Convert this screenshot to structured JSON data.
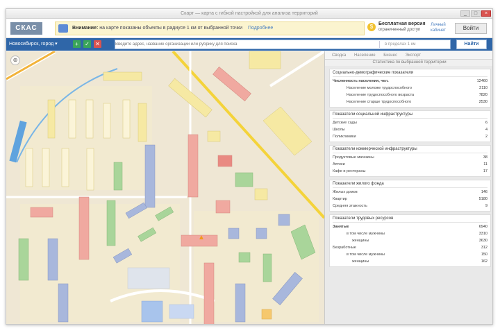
{
  "window": {
    "title": "Скарт — карта с гибкой настройкой для анализа территорий",
    "controls": [
      "_",
      "□",
      "×"
    ]
  },
  "header": {
    "logo": "СКАС",
    "banner": {
      "lead": "Внимание:",
      "text": "на карте показаны объекты в радиусе 1 км от выбранной точки",
      "link": "Подробнее"
    },
    "promo": {
      "title": "Бесплатная версия",
      "subtitle": "ограниченный доступ"
    },
    "user_link": "Личный кабинет",
    "login_label": "Войти"
  },
  "toolbar": {
    "city": "Новосибирск, город ▾",
    "buttons": [
      {
        "glyph": "+",
        "color": "#3aa55a"
      },
      {
        "glyph": "✓",
        "color": "#3aa55a"
      },
      {
        "glyph": "✕",
        "color": "#d9534f"
      }
    ],
    "search_placeholder": "Введите адрес, название организации или рубрику для поиска",
    "filter_label": "в пределах 1 км",
    "find_label": "Найти"
  },
  "map": {
    "compass": "⊕",
    "colors": {
      "road": "#ffffff",
      "main_road": "#f4d33a",
      "water": "#79b6e6",
      "residential": "#f2e9c7",
      "red": "#f0a9a0",
      "green": "#a9d59a",
      "blue": "#a8b7dc",
      "yellow": "#f6e9a3"
    }
  },
  "panel": {
    "tabs": [
      "Сводка",
      "Население",
      "Бизнес",
      "Экспорт"
    ],
    "subtitle": "Статистика по выбранной территории",
    "sections": [
      {
        "title": "Социально-демографические показатели",
        "rows": [
          {
            "label": "Численность населения, чел.",
            "value": "12460",
            "style": "bold"
          },
          {
            "label": "Население моложе трудоспособного",
            "value": "2110",
            "style": "indent"
          },
          {
            "label": "Население трудоспособного возраста",
            "value": "7820",
            "style": "indent"
          },
          {
            "label": "Население старше трудоспособного",
            "value": "2530",
            "style": "indent"
          }
        ]
      },
      {
        "title": "Показатели социальной инфраструктуры",
        "rows": [
          {
            "label": "Детские сады",
            "value": "6",
            "style": ""
          },
          {
            "label": "Школы",
            "value": "4",
            "style": ""
          },
          {
            "label": "Поликлиники",
            "value": "2",
            "style": ""
          }
        ]
      },
      {
        "title": "Показатели коммерческой инфраструктуры",
        "rows": [
          {
            "label": "Продуктовые магазины",
            "value": "38",
            "style": ""
          },
          {
            "label": "Аптеки",
            "value": "11",
            "style": ""
          },
          {
            "label": "Кафе и рестораны",
            "value": "17",
            "style": ""
          }
        ]
      },
      {
        "title": "Показатели жилого фонда",
        "rows": [
          {
            "label": "Жилых домов",
            "value": "146",
            "style": ""
          },
          {
            "label": "Квартир",
            "value": "5180",
            "style": ""
          },
          {
            "label": "Средняя этажность",
            "value": "9",
            "style": ""
          }
        ]
      },
      {
        "title": "Показатели трудовых ресурсов",
        "rows": [
          {
            "label": "Занятые",
            "value": "6940",
            "style": "bold"
          },
          {
            "label": "в том числе мужчины",
            "value": "3310",
            "style": "indent"
          },
          {
            "label": "женщины",
            "value": "3630",
            "style": "indent2"
          },
          {
            "label": "Безработные",
            "value": "312",
            "style": ""
          },
          {
            "label": "в том числе мужчины",
            "value": "150",
            "style": "indent"
          },
          {
            "label": "женщины",
            "value": "162",
            "style": "indent2"
          }
        ]
      }
    ]
  }
}
